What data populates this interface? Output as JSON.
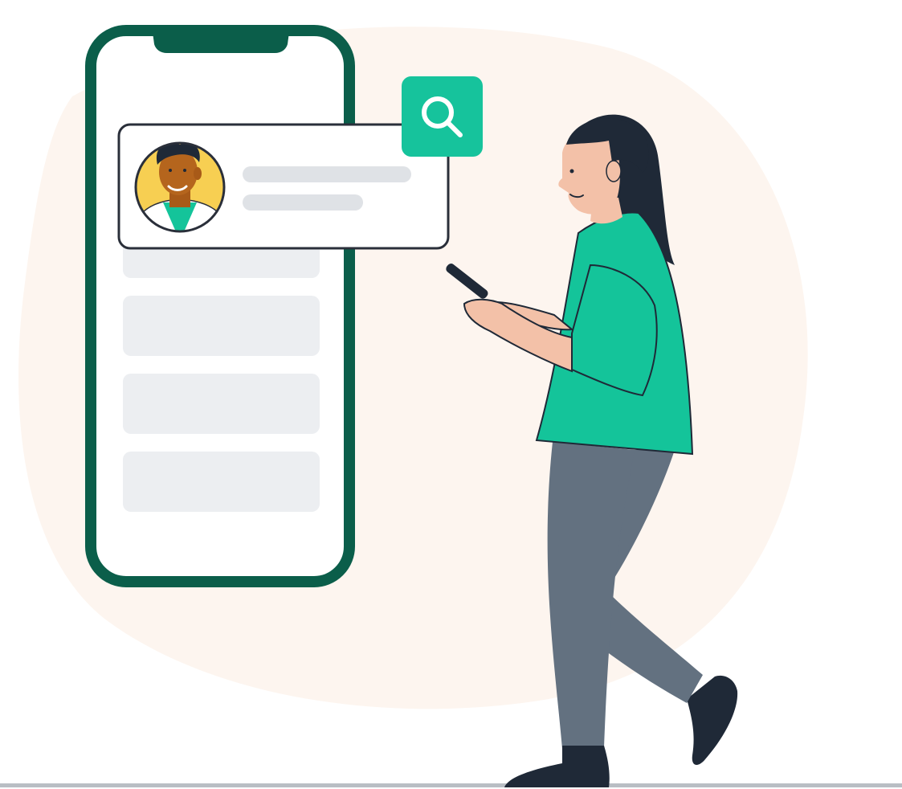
{
  "scene": {
    "description_label": "",
    "colors": {
      "background": "#ffffff",
      "blob": "#fdf5ef",
      "phone_frame": "#0b5e4a",
      "phone_screen": "#ffffff",
      "card_border": "#2a2f3a",
      "placeholder_line": "#dfe2e6",
      "placeholder_block": "#eceef1",
      "search_badge": "#16c39c",
      "avatar_bg": "#f7cf52",
      "shirt": "#14c49a",
      "pants": "#637180",
      "hair": "#1f2937",
      "skin": "#f3c1a8",
      "avatar_skin": "#b5651d",
      "floor_line": "#b9bec4"
    },
    "icons": {
      "search": "search-icon",
      "avatar": "doctor-avatar-icon"
    }
  }
}
